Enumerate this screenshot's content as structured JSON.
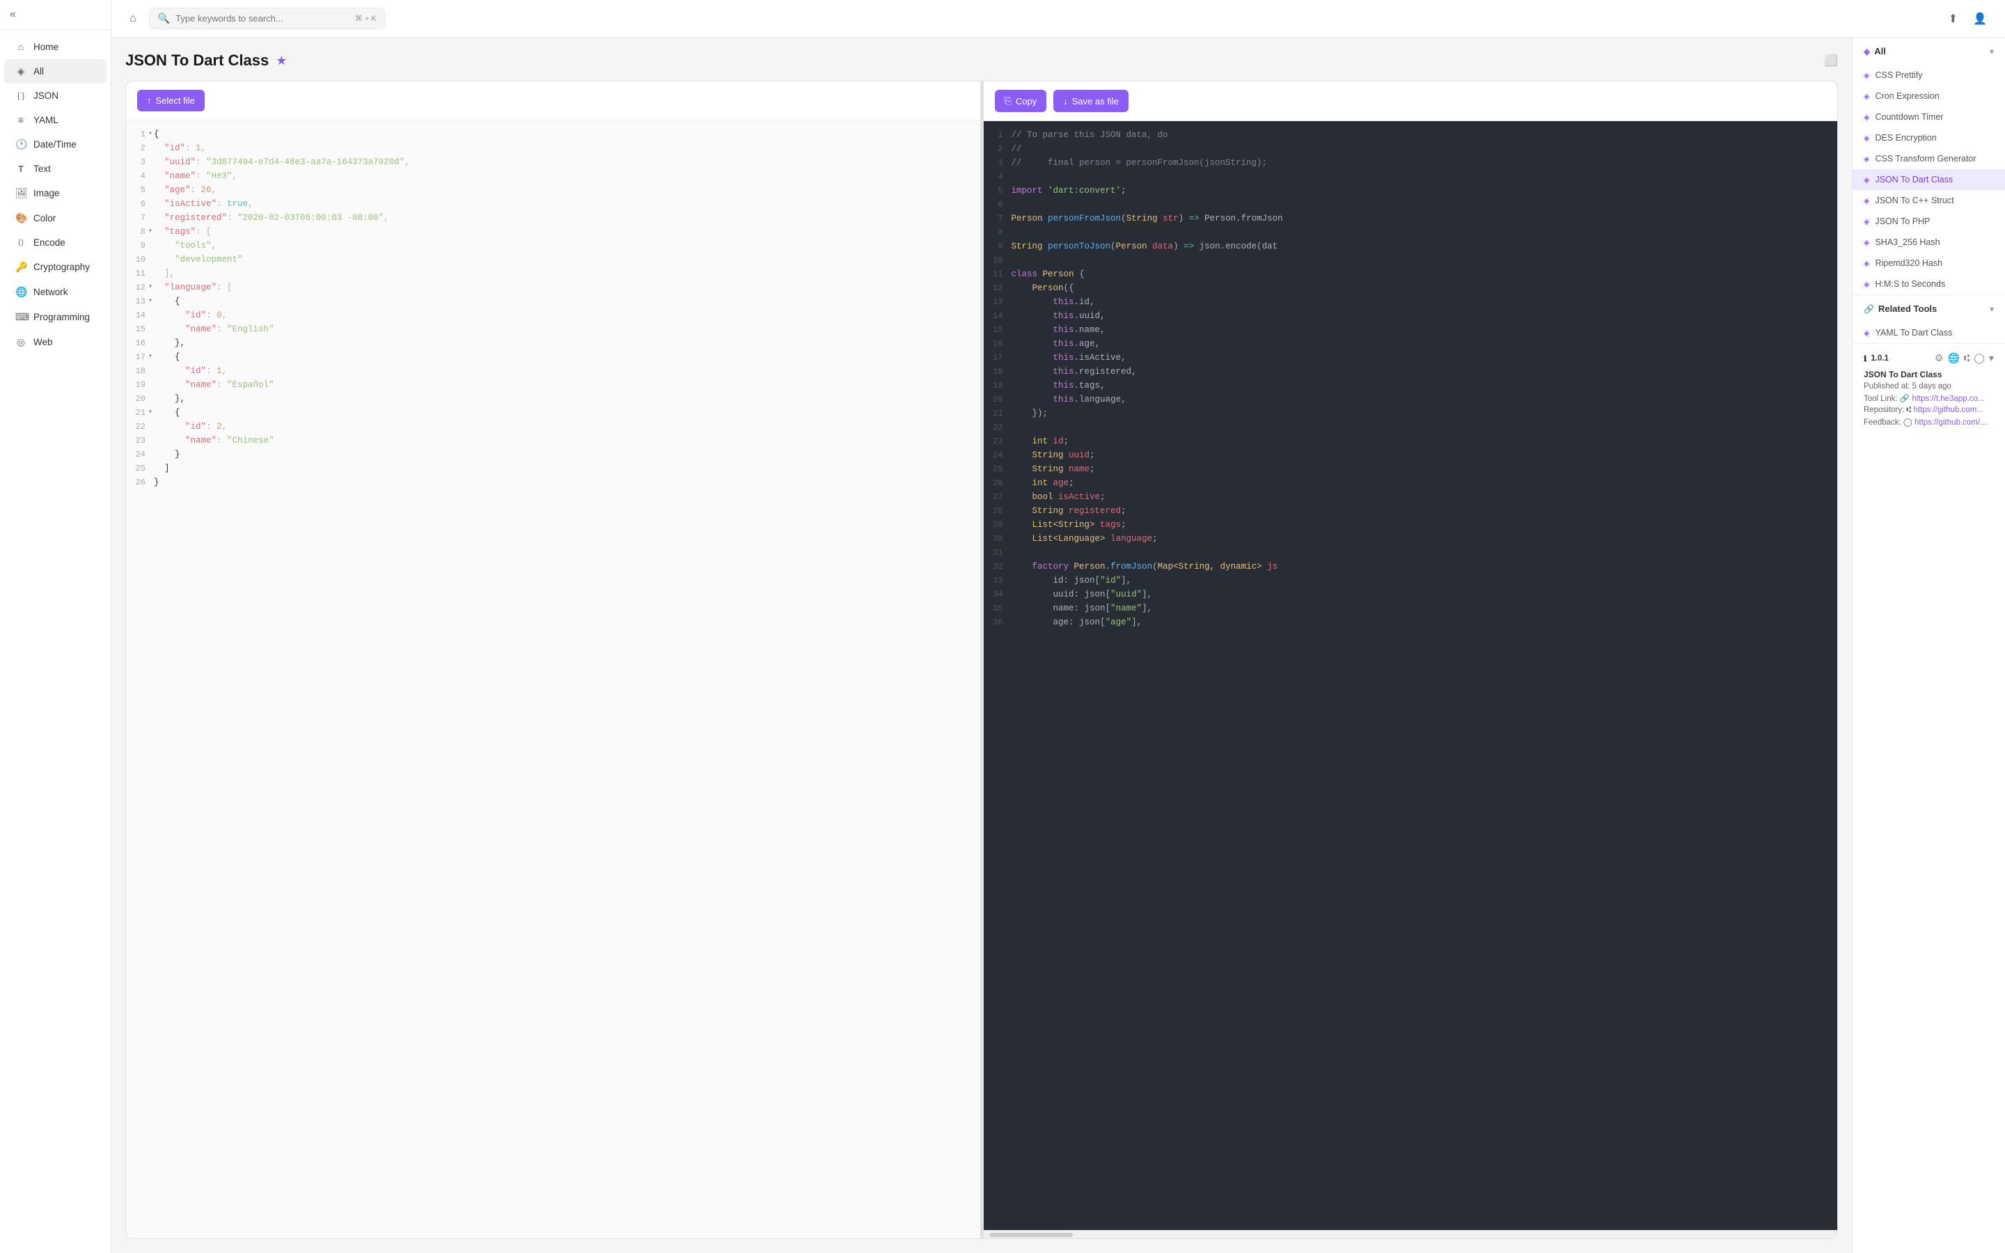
{
  "sidebar": {
    "items": [
      {
        "id": "home",
        "label": "Home",
        "icon": "⌂"
      },
      {
        "id": "all",
        "label": "All",
        "icon": "◈",
        "active": true
      },
      {
        "id": "json",
        "label": "JSON",
        "icon": "{ }"
      },
      {
        "id": "yaml",
        "label": "YAML",
        "icon": "≡"
      },
      {
        "id": "datetime",
        "label": "Date/Time",
        "icon": "🕐"
      },
      {
        "id": "text",
        "label": "Text",
        "icon": "T"
      },
      {
        "id": "image",
        "label": "Image",
        "icon": "🖼"
      },
      {
        "id": "color",
        "label": "Color",
        "icon": "🎨"
      },
      {
        "id": "encode",
        "label": "Encode",
        "icon": "⟨⟩"
      },
      {
        "id": "cryptography",
        "label": "Cryptography",
        "icon": "🔑"
      },
      {
        "id": "network",
        "label": "Network",
        "icon": "🌐"
      },
      {
        "id": "programming",
        "label": "Programming",
        "icon": "⌨"
      },
      {
        "id": "web",
        "label": "Web",
        "icon": "◎"
      }
    ]
  },
  "topbar": {
    "search_placeholder": "Type keywords to search...",
    "search_shortcut": "⌘ + K"
  },
  "page": {
    "title": "JSON To Dart Class",
    "select_file_label": "Select file",
    "copy_label": "Copy",
    "save_as_file_label": "Save as file"
  },
  "left_code": {
    "lines": [
      {
        "num": 1,
        "content": "{",
        "toggle": true
      },
      {
        "num": 2,
        "content": "  \"id\": 1,"
      },
      {
        "num": 3,
        "content": "  \"uuid\": \"3d877494-e7d4-48e3-aa7a-164373a7920d\","
      },
      {
        "num": 4,
        "content": "  \"name\": \"He3\","
      },
      {
        "num": 5,
        "content": "  \"age\": 26,"
      },
      {
        "num": 6,
        "content": "  \"isActive\": true,"
      },
      {
        "num": 7,
        "content": "  \"registered\": \"2020-02-03T06:00:03 -08:00\","
      },
      {
        "num": 8,
        "content": "  \"tags\": [",
        "toggle": true
      },
      {
        "num": 9,
        "content": "    \"tools\","
      },
      {
        "num": 10,
        "content": "    \"development\""
      },
      {
        "num": 11,
        "content": "  ],"
      },
      {
        "num": 12,
        "content": "  \"language\": [",
        "toggle": true
      },
      {
        "num": 13,
        "content": "    {",
        "toggle": true
      },
      {
        "num": 14,
        "content": "      \"id\": 0,"
      },
      {
        "num": 15,
        "content": "      \"name\": \"English\""
      },
      {
        "num": 16,
        "content": "    },"
      },
      {
        "num": 17,
        "content": "    {",
        "toggle": true
      },
      {
        "num": 18,
        "content": "      \"id\": 1,"
      },
      {
        "num": 19,
        "content": "      \"name\": \"Español\""
      },
      {
        "num": 20,
        "content": "    },"
      },
      {
        "num": 21,
        "content": "    {",
        "toggle": true
      },
      {
        "num": 22,
        "content": "      \"id\": 2,"
      },
      {
        "num": 23,
        "content": "      \"name\": \"Chinese\""
      },
      {
        "num": 24,
        "content": "    }"
      },
      {
        "num": 25,
        "content": "  ]"
      },
      {
        "num": 26,
        "content": "}"
      }
    ]
  },
  "right_code": {
    "lines": [
      {
        "num": 1,
        "content": "// To parse this JSON data, do"
      },
      {
        "num": 2,
        "content": "//"
      },
      {
        "num": 3,
        "content": "//     final person = personFromJson(jsonString);"
      },
      {
        "num": 4,
        "content": ""
      },
      {
        "num": 5,
        "content": "import 'dart:convert';"
      },
      {
        "num": 6,
        "content": ""
      },
      {
        "num": 7,
        "content": "Person personFromJson(String str) => Person.fromJson"
      },
      {
        "num": 8,
        "content": ""
      },
      {
        "num": 9,
        "content": "String personToJson(Person data) => json.encode(dat"
      },
      {
        "num": 10,
        "content": ""
      },
      {
        "num": 11,
        "content": "class Person {"
      },
      {
        "num": 12,
        "content": "    Person({"
      },
      {
        "num": 13,
        "content": "        this.id,"
      },
      {
        "num": 14,
        "content": "        this.uuid,"
      },
      {
        "num": 15,
        "content": "        this.name,"
      },
      {
        "num": 16,
        "content": "        this.age,"
      },
      {
        "num": 17,
        "content": "        this.isActive,"
      },
      {
        "num": 18,
        "content": "        this.registered,"
      },
      {
        "num": 19,
        "content": "        this.tags,"
      },
      {
        "num": 20,
        "content": "        this.language,"
      },
      {
        "num": 21,
        "content": "    });"
      },
      {
        "num": 22,
        "content": ""
      },
      {
        "num": 23,
        "content": "    int id;"
      },
      {
        "num": 24,
        "content": "    String uuid;"
      },
      {
        "num": 25,
        "content": "    String name;"
      },
      {
        "num": 26,
        "content": "    int age;"
      },
      {
        "num": 27,
        "content": "    bool isActive;"
      },
      {
        "num": 28,
        "content": "    String registered;"
      },
      {
        "num": 29,
        "content": "    List<String> tags;"
      },
      {
        "num": 30,
        "content": "    List<Language> language;"
      },
      {
        "num": 31,
        "content": ""
      },
      {
        "num": 32,
        "content": "    factory Person.fromJson(Map<String, dynamic> js"
      },
      {
        "num": 33,
        "content": "        id: json[\"id\"],"
      },
      {
        "num": 34,
        "content": "        uuid: json[\"uuid\"],"
      },
      {
        "num": 35,
        "content": "        name: json[\"name\"],"
      },
      {
        "num": 36,
        "content": "        age: json[\"age\"],"
      }
    ]
  },
  "right_sidebar": {
    "all_section": {
      "title": "All",
      "items": [
        {
          "label": "CSS Prettify",
          "active": false
        },
        {
          "label": "Cron Expression",
          "active": false
        },
        {
          "label": "Countdown Timer",
          "active": false
        },
        {
          "label": "DES Encryption",
          "active": false
        },
        {
          "label": "CSS Transform Generator",
          "active": false
        },
        {
          "label": "JSON To Dart Class",
          "active": true
        },
        {
          "label": "JSON To C++ Struct",
          "active": false
        },
        {
          "label": "JSON To PHP",
          "active": false
        },
        {
          "label": "SHA3_256 Hash",
          "active": false
        },
        {
          "label": "Ripemd320 Hash",
          "active": false
        },
        {
          "label": "H:M:S to Seconds",
          "active": false
        }
      ]
    },
    "related_section": {
      "title": "Related Tools",
      "items": [
        {
          "label": "YAML To Dart Class"
        }
      ]
    },
    "version": {
      "number": "1.0.1",
      "tool_name": "JSON To Dart Class",
      "published": "Published at: 5 days ago",
      "tool_link_label": "Tool Link:",
      "tool_link_url": "https://t.he3app.co...",
      "repo_label": "Repository:",
      "repo_url": "https://github.com...",
      "feedback_label": "Feedback:",
      "feedback_url": "https://github.com/..."
    }
  }
}
